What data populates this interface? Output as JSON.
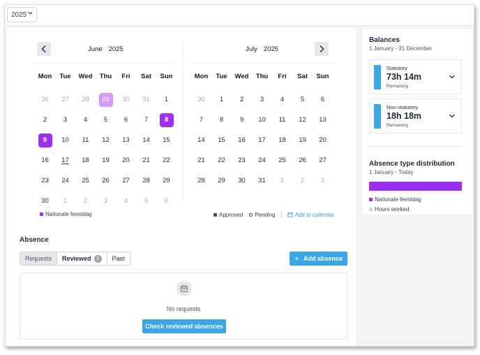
{
  "year_select": {
    "value": "2025"
  },
  "calendar": {
    "weekdays": [
      "Mon",
      "Tue",
      "Wed",
      "Thu",
      "Fri",
      "Sat",
      "Sun"
    ],
    "months": [
      {
        "name": "June",
        "year": "2025",
        "weeks": [
          [
            "26",
            "27",
            "28",
            "29",
            "30",
            "31",
            "1"
          ],
          [
            "2",
            "3",
            "4",
            "5",
            "6",
            "7",
            "8"
          ],
          [
            "9",
            "10",
            "11",
            "12",
            "13",
            "14",
            "15"
          ],
          [
            "16",
            "17",
            "18",
            "19",
            "20",
            "21",
            "22"
          ],
          [
            "23",
            "24",
            "25",
            "26",
            "27",
            "28",
            "29"
          ],
          [
            "30",
            "1",
            "2",
            "3",
            "4",
            "5",
            "6"
          ]
        ]
      },
      {
        "name": "July",
        "year": "2025",
        "weeks": [
          [
            "30",
            "1",
            "2",
            "3",
            "4",
            "5",
            "6"
          ],
          [
            "7",
            "8",
            "9",
            "10",
            "11",
            "12",
            "13"
          ],
          [
            "14",
            "15",
            "16",
            "17",
            "18",
            "19",
            "20"
          ],
          [
            "21",
            "22",
            "23",
            "24",
            "25",
            "26",
            "27"
          ],
          [
            "28",
            "29",
            "30",
            "31",
            "1",
            "2",
            "3"
          ]
        ]
      }
    ],
    "holiday_color": "#9d2ff0",
    "prev_icon": "chevron-left-icon",
    "next_icon": "chevron-right-icon"
  },
  "legend": {
    "holiday": "Nationale feestdag",
    "approved": "Approved",
    "pending": "Pending",
    "add_to_calendar": "Add to calendar"
  },
  "absence": {
    "title": "Absence",
    "tabs": [
      {
        "label": "Requests",
        "active": true
      },
      {
        "label": "Reviewed",
        "badge": "2"
      },
      {
        "label": "Past"
      }
    ],
    "add_button": "Add absence",
    "empty_text": "No requests",
    "check_button": "Check reviewed absences"
  },
  "balances": {
    "title": "Balances",
    "period": "1 January - 31 December",
    "items": [
      {
        "name": "Statutory",
        "value": "73h 14m",
        "sub": "Remaining"
      },
      {
        "name": "Non-statutory",
        "value": "18h 18m",
        "sub": "Remaining"
      }
    ]
  },
  "distribution": {
    "title": "Absence type distribution",
    "period": "1 January - Today",
    "legend": [
      {
        "label": "Nationale feestdag",
        "color": "#9d2ff0"
      },
      {
        "label": "Hours worked",
        "color": "#d1d5db"
      }
    ],
    "holiday_share": 1.0
  },
  "accent_color": "#3aa6e6"
}
